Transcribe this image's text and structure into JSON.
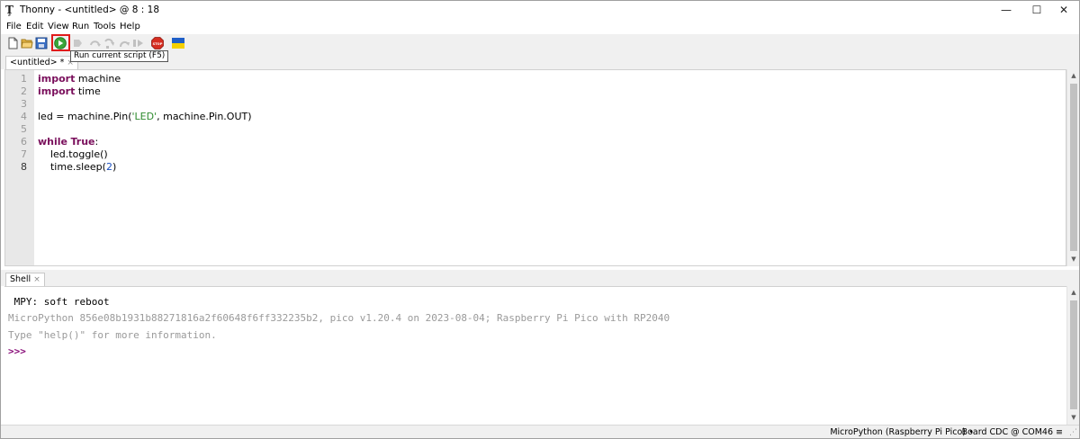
{
  "window": {
    "title": "Thonny  -  <untitled>  @  8 : 18",
    "app_icon": "Ţ",
    "controls": {
      "minimize": "—",
      "maximize": "☐",
      "close": "✕"
    }
  },
  "menu": [
    "File",
    "Edit",
    "View",
    "Run",
    "Tools",
    "Help"
  ],
  "toolbar": {
    "icons": [
      "new-file-icon",
      "open-folder-icon",
      "save-icon",
      "run-icon",
      "debug-icon",
      "step-over-icon",
      "step-into-icon",
      "step-out-icon",
      "resume-icon",
      "stop-icon",
      "ukraine-flag-icon"
    ],
    "stop_label": "STOP",
    "tooltip": "Run current script (F5)",
    "colors": {
      "run": "#3aa63a",
      "stop": "#d62d20",
      "highlight": "#e01b1b",
      "flag_blue": "#1f5fc8",
      "flag_yellow": "#f5d000"
    }
  },
  "editor": {
    "tab_label": "<untitled> *",
    "tab_close": "×",
    "line_numbers": [
      "1",
      "2",
      "3",
      "4",
      "5",
      "6",
      "7",
      "8"
    ],
    "code": {
      "l1_kw": "import",
      "l1_rest": " machine",
      "l2_kw": "import",
      "l2_rest": " time",
      "l4_a": "led = machine.Pin(",
      "l4_str": "'LED'",
      "l4_b": ", machine.Pin.OUT)",
      "l6_kw1": "while",
      "l6_sp": " ",
      "l6_kw2": "True",
      "l6_colon": ":",
      "l7": "    led.toggle()",
      "l8_a": "    time.sleep(",
      "l8_num": "2",
      "l8_b": ")"
    }
  },
  "shell": {
    "tab_label": "Shell",
    "tab_close": "×",
    "lines": {
      "soft_reboot": " MPY: soft reboot",
      "version": "MicroPython 856e08b1931b88271816a2f60648f6ff332235b2, pico v1.20.4 on 2023-08-04; Raspberry Pi Pico with RP2040",
      "help": "Type \"help()\" for more information.",
      "prompt": ">>>"
    }
  },
  "status": {
    "interpreter": "MicroPython (Raspberry Pi Pico)",
    "separator": "•",
    "port": "Board CDC @ COM46 ≡"
  },
  "scrollbar": {
    "up": "▲",
    "down": "▼"
  }
}
